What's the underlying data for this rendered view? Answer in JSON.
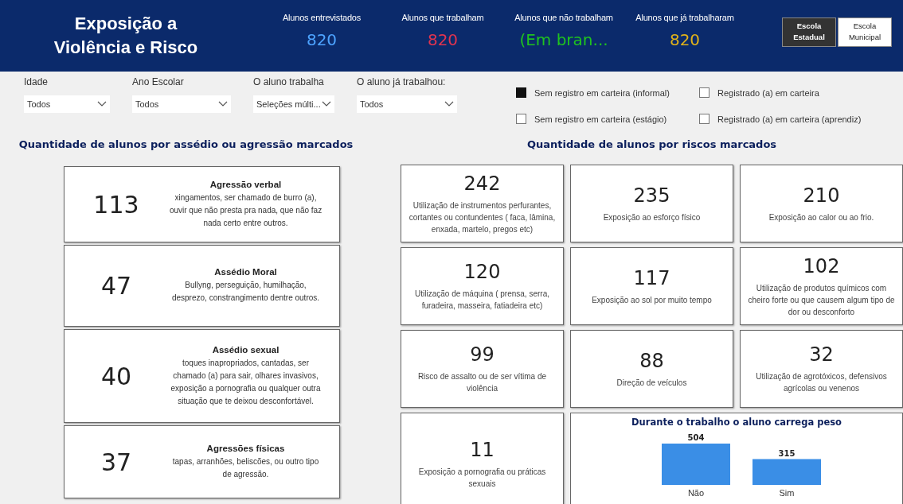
{
  "header": {
    "title": "Exposição a Violência e Risco",
    "kpis": [
      {
        "label": "Alunos entrevistados",
        "value": "820",
        "color": "#4da3ff"
      },
      {
        "label": "Alunos que trabalham",
        "value": "820",
        "color": "#e0344f"
      },
      {
        "label": "Alunos que não trabalham",
        "value": "(Em bran...",
        "color": "#1fc21f"
      },
      {
        "label": "Alunos que já trabalharam",
        "value": "820",
        "color": "#e0b21a"
      }
    ],
    "school_toggle": [
      {
        "label": "Escola Estadual",
        "selected": true
      },
      {
        "label": "Escola Municipal",
        "selected": false
      }
    ]
  },
  "filters": [
    {
      "label": "Idade",
      "value": "Todos"
    },
    {
      "label": "Ano Escolar",
      "value": "Todos"
    },
    {
      "label": "O aluno trabalha",
      "value": "Seleções múlti..."
    },
    {
      "label": "O aluno já trabalhou:",
      "value": "Todos"
    }
  ],
  "checkboxes": [
    {
      "label": "Sem registro em carteira (informal)",
      "checked": true
    },
    {
      "label": "Registrado (a) em carteira",
      "checked": false
    },
    {
      "label": "Sem registro em carteira (estágio)",
      "checked": false
    },
    {
      "label": "Registrado (a) em carteira (aprendiz)",
      "checked": false
    }
  ],
  "harassment": {
    "title": "Quantidade de alunos por assédio ou agressão marcados",
    "cards": [
      {
        "value": "113",
        "title": "Agressão verbal",
        "description": "xingamentos, ser chamado de burro (a), ouvir que não presta pra nada, que não faz nada certo entre outros."
      },
      {
        "value": "47",
        "title": "Assédio Moral",
        "description": "Bullyng, perseguição, humilhação, desprezo, constrangimento dentre outros."
      },
      {
        "value": "40",
        "title": "Assédio sexual",
        "description": "toques inapropriados, cantadas, ser chamado (a) para sair, olhares invasivos, exposição a pornografia ou qualquer outra situação que te deixou desconfortável."
      },
      {
        "value": "37",
        "title": "Agressões físicas",
        "description": "tapas, arranhões, beliscões, ou outro tipo de agressão."
      }
    ]
  },
  "risks": {
    "title": "Quantidade de alunos por riscos marcados",
    "cards": [
      {
        "value": "242",
        "description": "Utilização de instrumentos perfurantes, cortantes ou contundentes ( faca, lâmina, enxada, martelo, pregos etc)"
      },
      {
        "value": "235",
        "description": "Exposição ao esforço físico"
      },
      {
        "value": "210",
        "description": "Exposição ao calor ou ao frio."
      },
      {
        "value": "120",
        "description": "Utilização de máquina ( prensa, serra, furadeira, masseira, fatiadeira etc)"
      },
      {
        "value": "117",
        "description": "Exposição ao sol por muito tempo"
      },
      {
        "value": "102",
        "description": "Utilização de produtos químicos com cheiro forte ou que causem algum tipo de dor ou desconforto"
      },
      {
        "value": "99",
        "description": "Risco de assalto ou de ser vítima de violência"
      },
      {
        "value": "88",
        "description": "Direção de veículos"
      },
      {
        "value": "32",
        "description": "Utilização de agrotóxicos, defensivos agrícolas ou venenos"
      },
      {
        "value": "11",
        "description": "Exposição a pornografia ou práticas sexuais"
      }
    ],
    "chart": {
      "chart_data": {
        "type": "bar",
        "title": "Durante o trabalho o aluno carrega peso",
        "categories": [
          "Não",
          "Sim"
        ],
        "series": [
          {
            "color": "#3a8ee6",
            "values": [
              504,
              315
            ]
          }
        ],
        "data_labels": true
      }
    }
  }
}
